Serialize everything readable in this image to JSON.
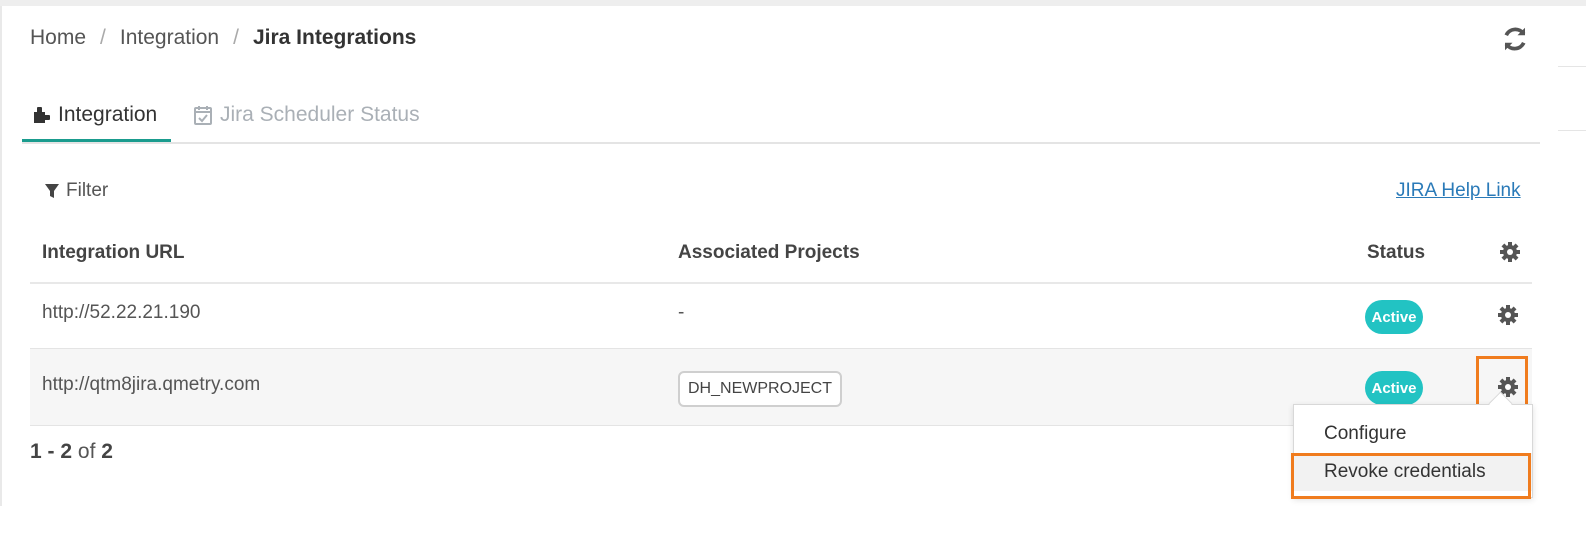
{
  "breadcrumb": {
    "home": "Home",
    "separator": "/",
    "integration": "Integration",
    "current": "Jira Integrations"
  },
  "toolbar": {
    "refresh_icon": "refresh-icon"
  },
  "tabs": [
    {
      "label": "Integration",
      "icon": "puzzle-icon",
      "active": true
    },
    {
      "label": "Jira Scheduler Status",
      "icon": "calendar-check-icon",
      "active": false
    }
  ],
  "filter": {
    "label": "Filter",
    "icon": "filter-icon"
  },
  "help_link": {
    "label": "JIRA Help Link"
  },
  "table": {
    "columns": {
      "url": "Integration URL",
      "projects": "Associated Projects",
      "status": "Status",
      "settings_icon": "gear-icon"
    },
    "rows": [
      {
        "url": "http://52.22.21.190",
        "projects": "-",
        "status": "Active"
      },
      {
        "url": "http://qtm8jira.qmetry.com",
        "projects": "DH_NEWPROJECT",
        "status": "Active"
      }
    ]
  },
  "pagination": {
    "from": "1",
    "dash": "-",
    "to": "2",
    "of": "of",
    "total": "2"
  },
  "context_menu": {
    "items": [
      {
        "label": "Configure"
      },
      {
        "label": "Revoke credentials"
      }
    ]
  },
  "colors": {
    "accent": "#1a9c8e",
    "status_badge": "#22c3c3",
    "link": "#2a7ab8",
    "highlight": "#f07c1e"
  }
}
